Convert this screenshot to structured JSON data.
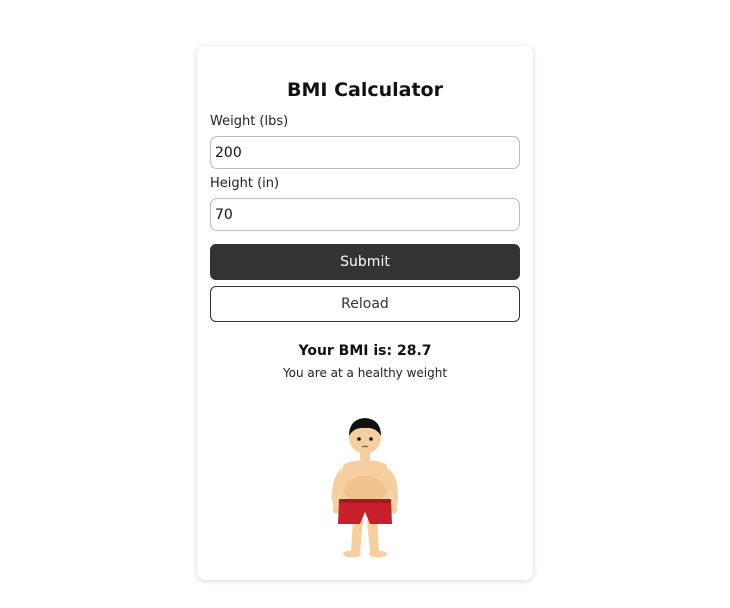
{
  "calculator": {
    "title": "BMI Calculator",
    "weight_label": "Weight (lbs)",
    "weight_value": "200",
    "height_label": "Height (in)",
    "height_value": "70",
    "submit_label": "Submit",
    "reload_label": "Reload",
    "result_prefix": "Your BMI is: ",
    "bmi_value": "28.7",
    "result_text": "Your BMI is: 28.7",
    "status_text": "You are at a healthy weight"
  },
  "colors": {
    "submit_bg": "#333333",
    "shorts": "#c8202a",
    "skin": "#f6cfa0",
    "hair": "#111111"
  },
  "illustration": {
    "icon": "person-figure-icon"
  }
}
